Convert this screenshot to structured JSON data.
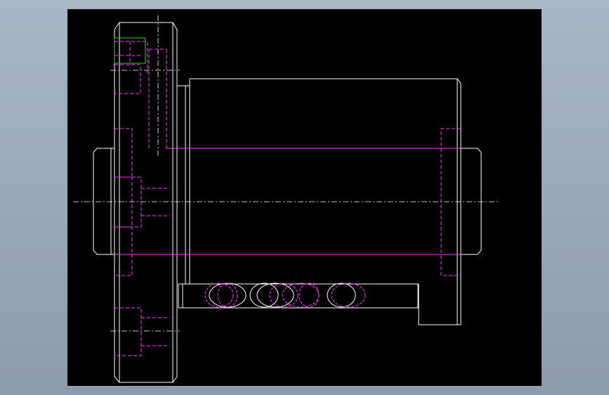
{
  "viewer": {
    "background": "#000000",
    "frame_color": "#8e9bad"
  },
  "drawing": {
    "subject": "ball-screw-nut-assembly",
    "colors": {
      "outline": "#ffffff",
      "hidden": "#ff33ff",
      "centerline": "#ffffff",
      "highlight": "#33cc33"
    }
  }
}
